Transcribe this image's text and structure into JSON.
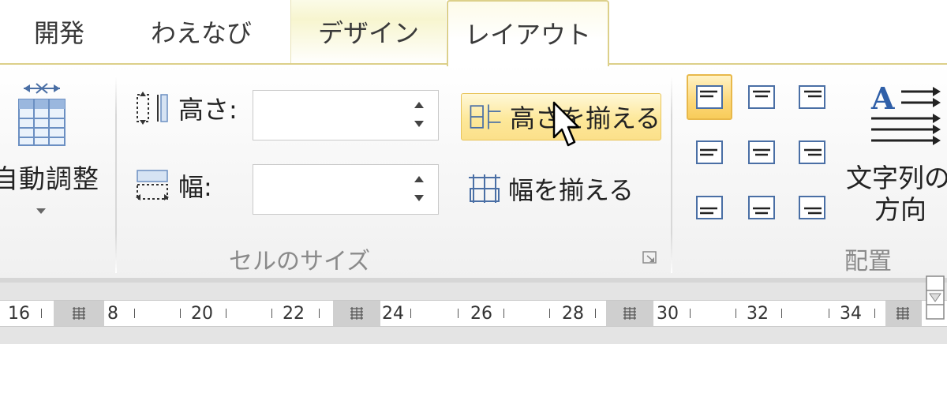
{
  "tabs": [
    {
      "label": "開発"
    },
    {
      "label": "わえなび"
    },
    {
      "label": "デザイン"
    },
    {
      "label": "レイアウト"
    }
  ],
  "autofit": {
    "label": "自動調整"
  },
  "cell_size": {
    "height_label": "高さ:",
    "height_value": "",
    "width_label": "幅:",
    "width_value": "",
    "group_label": "セルのサイズ"
  },
  "distribute": {
    "rows_label": "高さを揃える",
    "cols_label": "幅を揃える"
  },
  "alignment": {
    "text_direction_label_line1": "文字列の",
    "text_direction_label_line2": "方向",
    "group_label": "配置"
  },
  "ruler": {
    "numbers": [
      "16",
      "8",
      "20",
      "22",
      "24",
      "26",
      "28",
      "30",
      "32",
      "34"
    ]
  },
  "colors": {
    "active_tab_border": "#dcd08a",
    "button_highlight": "#fde89a",
    "group_label_gray": "#8a8a8a"
  }
}
